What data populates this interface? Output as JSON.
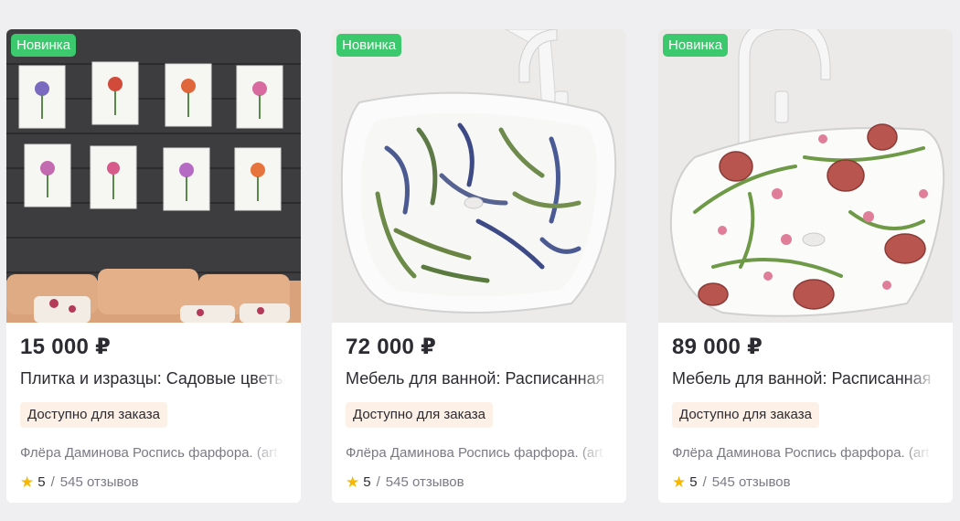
{
  "products": [
    {
      "badge": "Новинка",
      "image": "botanical-prints-wall-photo",
      "price": "15 000 ₽",
      "title": "Плитка и изразцы: Садовые цветы",
      "availability": "Доступно для заказа",
      "seller": "Флёра Даминова Роспись фарфора. (art",
      "rating": "5",
      "separator": "/",
      "reviews": "545 отзывов"
    },
    {
      "badge": "Новинка",
      "image": "leaf-pattern-sink-photo",
      "price": "72 000 ₽",
      "title": "Мебель для ванной: Расписанная раковина",
      "availability": "Доступно для заказа",
      "seller": "Флёра Даминова Роспись фарфора. (art",
      "rating": "5",
      "separator": "/",
      "reviews": "545 отзывов"
    },
    {
      "badge": "Новинка",
      "image": "pomegranate-pattern-sink-photo",
      "price": "89 000 ₽",
      "title": "Мебель для ванной: Расписанная раковина",
      "availability": "Доступно для заказа",
      "seller": "Флёра Даминова Роспись фарфора. (art",
      "rating": "5",
      "separator": "/",
      "reviews": "545 отзывов"
    }
  ],
  "colors": {
    "badge": "#3cc86c",
    "availability_bg": "#fdf0e6",
    "star": "#f6b800",
    "page_bg": "#efeff1"
  }
}
